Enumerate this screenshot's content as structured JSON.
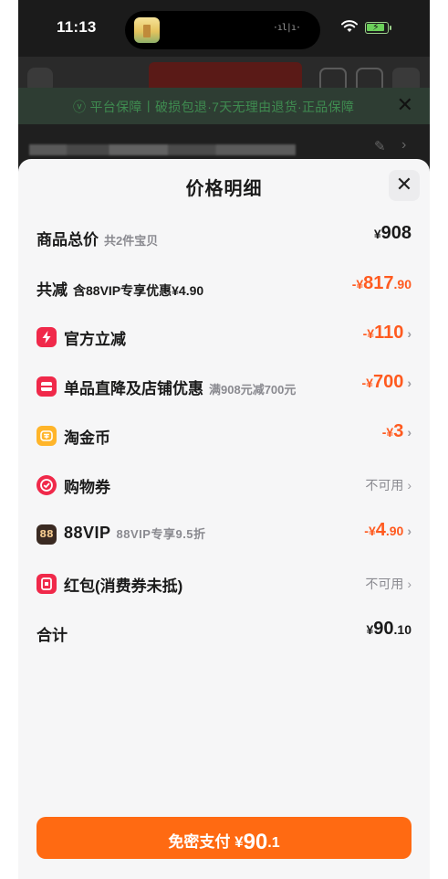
{
  "status_bar": {
    "time": "11:13",
    "wave": "·ıl|ı·"
  },
  "guarantee": {
    "text": "ⓥ 平台保障丨破损包退·7天无理由退货·正品保障",
    "close": "✕"
  },
  "sheet": {
    "title": "价格明细",
    "close": "✕"
  },
  "rows": {
    "total_goods": {
      "label": "商品总价",
      "sub": "共2件宝贝",
      "yen": "¥",
      "amount": "908"
    },
    "total_reduce": {
      "label": "共减",
      "sub": "含88VIP专享优惠¥4.90",
      "prefix": "-¥",
      "amount_int": "817",
      "amount_dec": ".90"
    },
    "official": {
      "label": "官方立减",
      "prefix": "-¥",
      "amount": "110",
      "chevron": "›"
    },
    "store": {
      "label": "单品直降及店铺优惠",
      "sub": "满908元减700元",
      "prefix": "-¥",
      "amount": "700",
      "chevron": "›"
    },
    "coin": {
      "label": "淘金币",
      "prefix": "-¥",
      "amount": "3",
      "chevron": "›"
    },
    "voucher": {
      "label": "购物券",
      "status": "不可用",
      "chevron": "›"
    },
    "vip": {
      "label": "88VIP",
      "sub": "88VIP专享9.5折",
      "prefix": "-¥",
      "amount_int": "4",
      "amount_dec": ".90",
      "chevron": "›",
      "icon_text": "88"
    },
    "redpack": {
      "label": "红包(消费券未抵)",
      "status": "不可用",
      "chevron": "›"
    },
    "sum": {
      "label": "合计",
      "yen": "¥",
      "amount_int": "90",
      "amount_dec": ".10"
    }
  },
  "pay": {
    "label": "免密支付",
    "yen": "¥",
    "amount_int": "90",
    "amount_dec": ".1"
  },
  "colors": {
    "accent": "#ff5a1f",
    "button": "#ff6a12",
    "red_icon": "#f0294a",
    "coin_icon": "#ffb52a"
  },
  "icons": {
    "official": "lightning-icon",
    "store": "shop-coupon-icon",
    "coin": "coin-icon",
    "voucher": "voucher-icon",
    "vip": "88vip-icon",
    "redpack": "red-packet-icon"
  }
}
